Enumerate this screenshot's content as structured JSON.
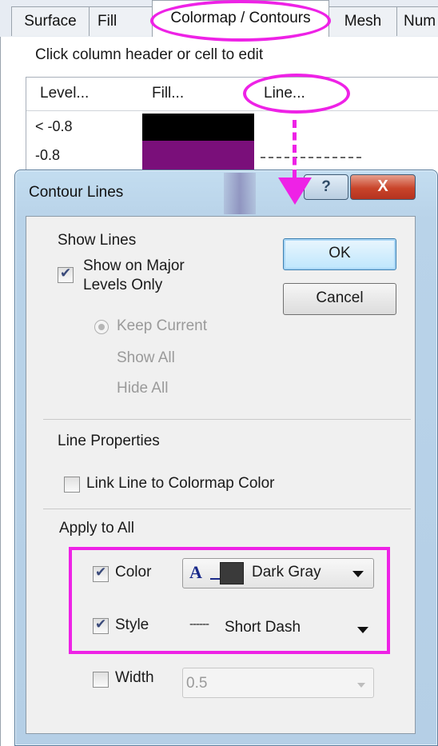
{
  "tabs": [
    {
      "label": "Surface"
    },
    {
      "label": "Fill"
    },
    {
      "label": "Colormap / Contours"
    },
    {
      "label": "Mesh"
    },
    {
      "label": "Num"
    }
  ],
  "hint": "Click column header or cell to edit",
  "table": {
    "headers": [
      "Level...",
      "Fill...",
      "Line..."
    ],
    "rows": [
      {
        "level": "< -0.8",
        "fill_color": "#000000"
      },
      {
        "level": "-0.8",
        "fill_color": "#7a0f7a"
      }
    ]
  },
  "dialog": {
    "title": "Contour Lines",
    "help_label": "?",
    "close_label": "X",
    "show_lines": {
      "heading": "Show Lines",
      "major_only_label": "Show on Major Levels Only",
      "major_only_checked": true,
      "options": [
        {
          "label": "Keep Current",
          "selected": true
        },
        {
          "label": "Show All",
          "selected": false
        },
        {
          "label": "Hide All",
          "selected": false
        }
      ]
    },
    "ok_label": "OK",
    "cancel_label": "Cancel",
    "line_properties": {
      "heading": "Line Properties",
      "link_label": "Link Line to Colormap Color",
      "link_checked": false
    },
    "apply_to_all": {
      "heading": "Apply to All",
      "color": {
        "label": "Color",
        "checked": true,
        "value": "Dark Gray",
        "glyph": "A",
        "swatch": "#3a3a3a"
      },
      "style": {
        "label": "Style",
        "checked": true,
        "value": "Short Dash",
        "dash_sample": "------"
      },
      "width": {
        "label": "Width",
        "checked": false,
        "value": "0.5"
      }
    }
  },
  "colors": {
    "annotation": "#ee22e6",
    "title_bar": "#b9d3e9"
  }
}
